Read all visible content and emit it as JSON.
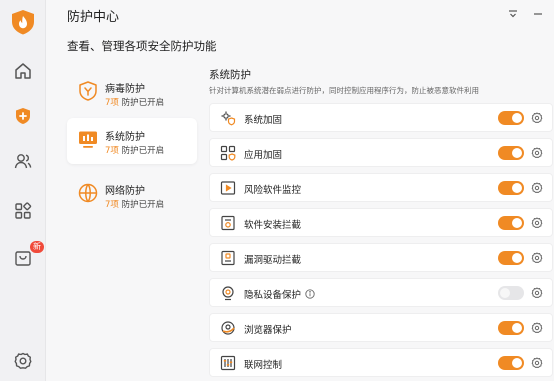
{
  "app": {
    "title": "防护中心",
    "subtitle": "查看、管理各项安全防护功能"
  },
  "sidebar": {
    "items": [
      {
        "name": "home-icon"
      },
      {
        "name": "shield-plus-icon",
        "active": true
      },
      {
        "name": "users-icon"
      },
      {
        "name": "apps-grid-icon"
      },
      {
        "name": "store-icon",
        "badge": "新"
      },
      {
        "name": "settings-gear-icon"
      }
    ]
  },
  "categories": [
    {
      "name": "病毒防护",
      "count": "7项",
      "status": "防护已开启",
      "icon": "virus-shield-icon",
      "active": false
    },
    {
      "name": "系统防护",
      "count": "7项",
      "status": "防护已开启",
      "icon": "system-monitor-icon",
      "active": true
    },
    {
      "name": "网络防护",
      "count": "7项",
      "status": "防护已开启",
      "icon": "globe-icon",
      "active": false
    }
  ],
  "section": {
    "title": "系统防护",
    "description": "针对计算机系统潜在弱点进行防护，同时控制应用程序行为，防止被恶意软件利用",
    "items": [
      {
        "label": "系统加固",
        "icon": "system-harden-icon",
        "enabled": true
      },
      {
        "label": "应用加固",
        "icon": "app-harden-icon",
        "enabled": true
      },
      {
        "label": "风险软件监控",
        "icon": "risk-software-icon",
        "enabled": true
      },
      {
        "label": "软件安装拦截",
        "icon": "install-block-icon",
        "enabled": true
      },
      {
        "label": "漏洞驱动拦截",
        "icon": "driver-block-icon",
        "enabled": true
      },
      {
        "label": "隐私设备保护",
        "icon": "webcam-icon",
        "enabled": false,
        "info": true
      },
      {
        "label": "浏览器保护",
        "icon": "browser-icon",
        "enabled": true
      },
      {
        "label": "联网控制",
        "icon": "network-control-icon",
        "enabled": true
      }
    ]
  },
  "colors": {
    "accent": "#f08a24",
    "toggle_off": "#e6e6e8",
    "badge": "#f04a3a"
  }
}
